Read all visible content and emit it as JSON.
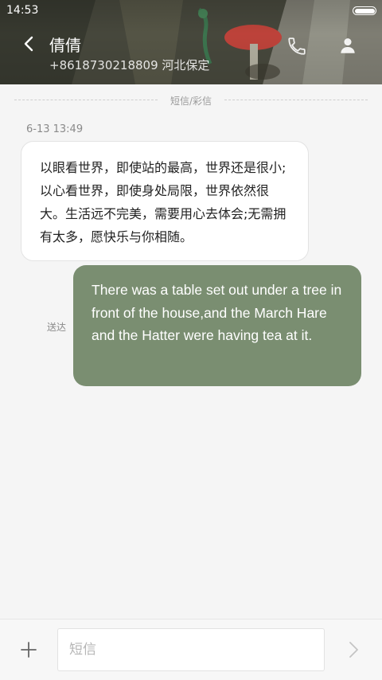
{
  "status_bar": {
    "time": "14:53",
    "battery_icon": "battery-icon"
  },
  "header": {
    "back_icon": "chevron-left-icon",
    "contact_name": "倩倩",
    "contact_detail": "+8618730218809 河北保定",
    "call_icon": "phone-icon",
    "contact_icon": "person-icon"
  },
  "thread": {
    "channel_label": "短信/彩信",
    "messages": [
      {
        "direction": "incoming",
        "timestamp": "6-13 13:49",
        "text": "以眼看世界，即使站的最高，世界还是很小;以心看世界，即使身处局限，世界依然很大。生活远不完美，需要用心去体会;无需拥有太多，愿快乐与你相随。"
      },
      {
        "direction": "outgoing",
        "status": "送达",
        "text": "There was a table set out under a tree in front of the house,and the March Hare and the Hatter were having tea at it."
      }
    ]
  },
  "composer": {
    "add_icon": "plus-icon",
    "placeholder": "短信",
    "value": "",
    "send_icon": "chevron-right-icon"
  },
  "colors": {
    "outgoing_bubble": "#7a8e71",
    "incoming_bubble": "#ffffff",
    "background": "#f5f5f5"
  }
}
